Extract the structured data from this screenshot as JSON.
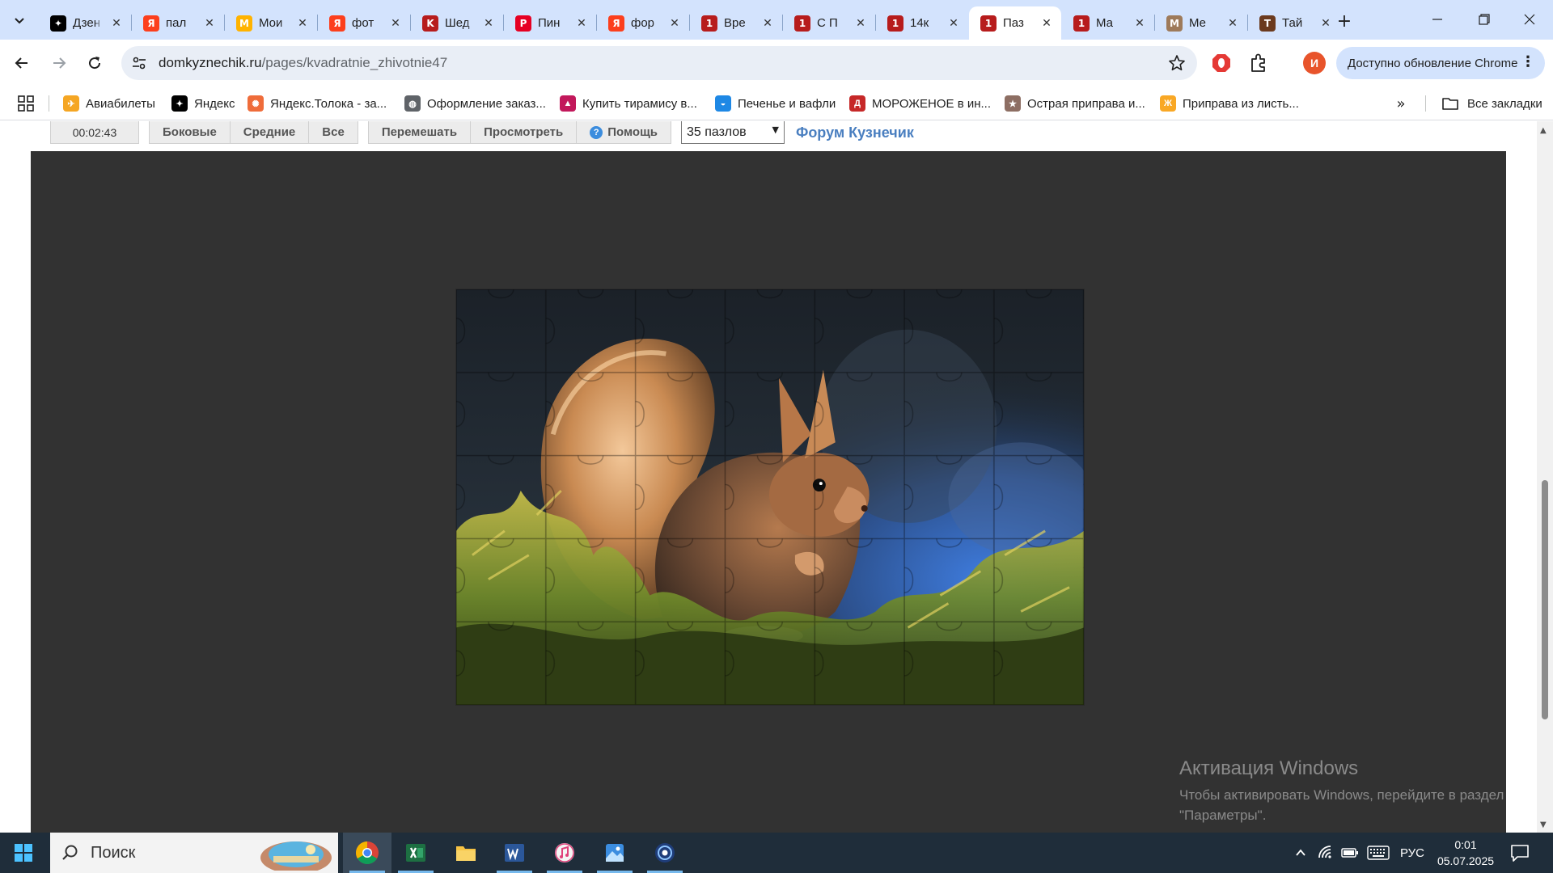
{
  "window": {
    "tabs": [
      {
        "title": "Дзен",
        "favicon": "zen",
        "color": "#000000",
        "glyph": "✦"
      },
      {
        "title": "пал",
        "favicon": "yandex",
        "color": "#fc3f1d",
        "glyph": "Я"
      },
      {
        "title": "Мои",
        "favicon": "market",
        "color": "#ffb300",
        "glyph": "М"
      },
      {
        "title": "фот",
        "favicon": "yandex",
        "color": "#fc3f1d",
        "glyph": "Я"
      },
      {
        "title": "Шед",
        "favicon": "kuznechik",
        "color": "#b71c1c",
        "glyph": "K"
      },
      {
        "title": "Пин",
        "favicon": "pinterest",
        "color": "#e60023",
        "glyph": "P"
      },
      {
        "title": "фор",
        "favicon": "yandex",
        "color": "#fc3f1d",
        "glyph": "Я"
      },
      {
        "title": "Вре",
        "favicon": "kuznechik",
        "color": "#b71c1c",
        "glyph": "1"
      },
      {
        "title": "С П",
        "favicon": "kuznechik",
        "color": "#b71c1c",
        "glyph": "1"
      },
      {
        "title": "14к",
        "favicon": "kuznechik",
        "color": "#b71c1c",
        "glyph": "1"
      },
      {
        "title": "Паз",
        "favicon": "kuznechik",
        "color": "#b71c1c",
        "glyph": "1",
        "active": true
      },
      {
        "title": "Ма",
        "favicon": "kuznechik",
        "color": "#b71c1c",
        "glyph": "1"
      },
      {
        "title": "Ме",
        "favicon": "meme",
        "color": "#9e7a5a",
        "glyph": "M"
      },
      {
        "title": "Тай",
        "favicon": "kuznechik",
        "color": "#6b3a1e",
        "glyph": "T"
      }
    ],
    "close_glyph": "✕",
    "new_tab_glyph": "+"
  },
  "toolbar": {
    "url_host": "domkyznechik.ru",
    "url_path": "/pages/kvadratnie_zhivotnie47",
    "profile_initial": "И",
    "update_label": "Доступно обновление Chrome",
    "menu_glyph": "⋮"
  },
  "bookmarks": {
    "items": [
      {
        "label": "Авиабилеты",
        "color": "#f5a623",
        "glyph": "✈"
      },
      {
        "label": "Яндекс",
        "color": "#000000",
        "glyph": "✦"
      },
      {
        "label": "Яндекс.Толока - за...",
        "color": "#ef6c3a",
        "glyph": "✺"
      },
      {
        "label": "Оформление заказ...",
        "color": "#5f6368",
        "glyph": "◍"
      },
      {
        "label": "Купить тирамису в...",
        "color": "#c2185b",
        "glyph": "▲"
      },
      {
        "label": "Печенье и вафли",
        "color": "#1e88e5",
        "glyph": "◒"
      },
      {
        "label": "МОРОЖЕНОЕ в ин...",
        "color": "#c62828",
        "glyph": "Д"
      },
      {
        "label": "Острая приправа и...",
        "color": "#8d6e63",
        "glyph": "★"
      },
      {
        "label": "Приправа из листь...",
        "color": "#f9a825",
        "glyph": "Ж"
      }
    ],
    "more_glyph": "»",
    "all_label": "Все закладки"
  },
  "puzzle": {
    "timer": "00:02:43",
    "buttons": {
      "sides": "Боковые",
      "middle": "Средние",
      "all": "Все",
      "shuffle": "Перемешать",
      "preview": "Просмотреть",
      "help": "Помощь"
    },
    "pieces_selected": "35 пазлов",
    "forum_link": "Форум Кузнечик"
  },
  "watermark": {
    "title": "Активация Windows",
    "subtitle": "Чтобы активировать Windows, перейдите в раздел \"Параметры\"."
  },
  "taskbar": {
    "search_label": "Поиск",
    "apps": [
      "chrome",
      "excel",
      "file-explorer",
      "word",
      "itunes",
      "photos",
      "media-app"
    ],
    "lang": "РУС",
    "time": "0:01",
    "date": "05.07.2025"
  }
}
